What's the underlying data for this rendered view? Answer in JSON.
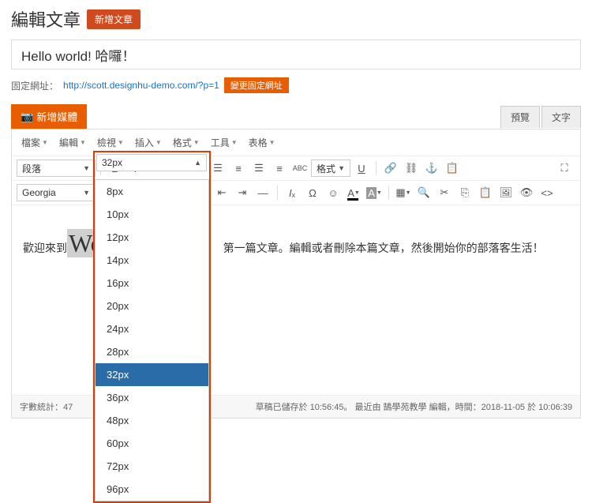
{
  "header": {
    "title": "編輯文章",
    "add_new": "新增文章"
  },
  "title_input": {
    "value": "Hello world! 哈囉！"
  },
  "permalink": {
    "label": "固定網址：",
    "url": "http://scott.designhu-demo.com/?p=1",
    "change": "變更固定網址"
  },
  "media": {
    "add": "新增媒體"
  },
  "tabs": {
    "visual": "預覽",
    "text": "文字"
  },
  "menubar": [
    "檔案",
    "編輯",
    "檢視",
    "插入",
    "格式",
    "工具",
    "表格"
  ],
  "toolbar1": {
    "paragraph": "段落",
    "format": "格式"
  },
  "toolbar2": {
    "font": "Georgia",
    "size": "32px"
  },
  "size_options": [
    "8px",
    "10px",
    "12px",
    "14px",
    "16px",
    "20px",
    "24px",
    "28px",
    "32px",
    "36px",
    "48px",
    "60px",
    "72px",
    "96px"
  ],
  "size_selected": "32px",
  "content": {
    "prefix": "歡迎來到 ",
    "selected": "Wo",
    "rest": "第一篇文章。編輯或者刪除本篇文章，然後開始你的部落客生活！"
  },
  "footer": {
    "wordcount": "字數統計：47",
    "status": "草稿已儲存於 10:56:45。 最近由 鵠學苑教學 編輯，時間：2018-11-05 於 10:06:39"
  }
}
